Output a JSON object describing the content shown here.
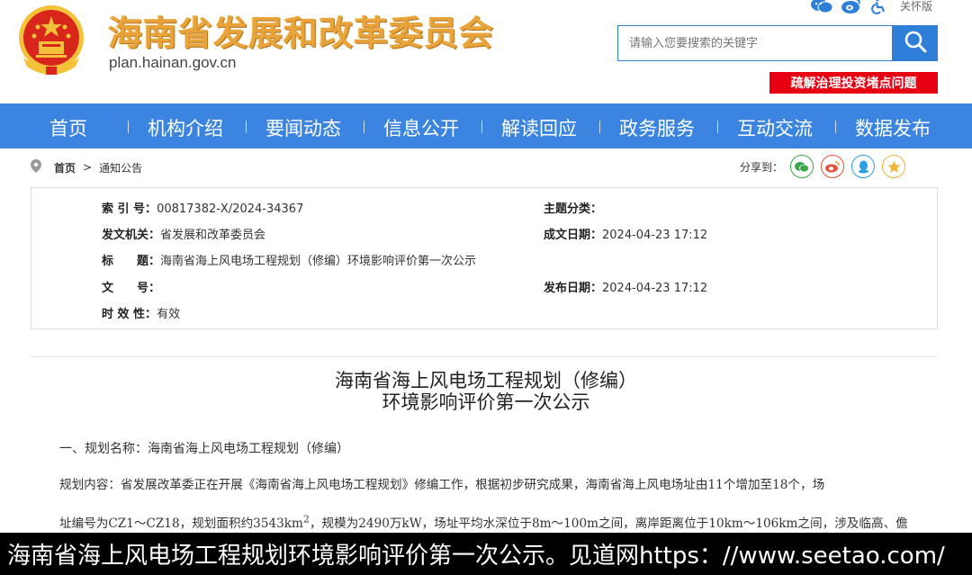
{
  "header": {
    "site_title": "海南省发展和改革委员会",
    "site_domain": "plan.hainan.gov.cn",
    "elder_mode": "关怀版",
    "search_placeholder": "请输入您要搜索的关键字",
    "banner": "疏解治理投资堵点问题"
  },
  "nav": {
    "items": [
      "首页",
      "机构介绍",
      "要闻动态",
      "信息公开",
      "解读回应",
      "政务服务",
      "互动交流",
      "数据发布"
    ]
  },
  "breadcrumb": {
    "home": "首页",
    "current": "通知公告",
    "separator": ">"
  },
  "share": {
    "label": "分享到："
  },
  "meta": {
    "index_key": "索 引 号：",
    "index_value": "00817382-X/2024-34367",
    "issuer_key": "发文机关：",
    "issuer_value": "省发展和改革委员会",
    "title_key": "标　　题：",
    "title_value": "海南省海上风电场工程规划（修编）环境影响评价第一次公示",
    "docno_key": "文　　号：",
    "docno_value": "",
    "validity_key": "时 效 性：",
    "validity_value": "有效",
    "topic_key": "主题分类：",
    "topic_value": "",
    "created_key": "成文日期：",
    "created_value": "2024-04-23 17:12",
    "published_key": "发布日期：",
    "published_value": "2024-04-23 17:12"
  },
  "article": {
    "title_line1": "海南省海上风电场工程规划（修编）",
    "title_line2": "环境影响评价第一次公示",
    "p1": "一、规划名称：海南省海上风电场工程规划（修编）",
    "p2": "规划内容：省发展改革委正在开展《海南省海上风电场工程规划》修编工作，根据初步研究成果，海南省海上风电场址由11个增加至18个，场",
    "p3_a": "址编号为CZ1～CZ18，规划面积约3543km",
    "p3_sup": "2",
    "p3_b": "，规模为2490万kW，场址平均水深位于8m～100m之间，离岸距离位于10km～106km之间，涉及临高、儋"
  },
  "caption": "海南省海上风电场工程规划环境影响评价第一次公示。见道网https：//www.seetao.com/",
  "colors": {
    "nav": "#3b84df",
    "banner": "#e60012",
    "title_gold": "#e8a33a"
  }
}
